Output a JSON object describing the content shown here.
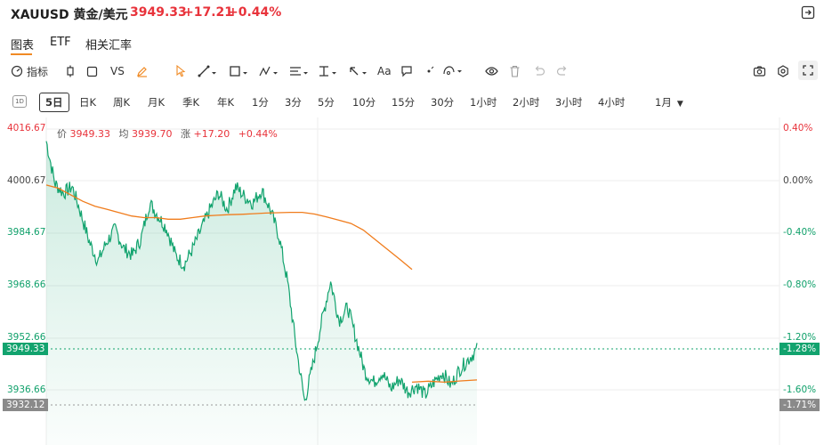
{
  "header": {
    "symbol": "XAUUSD 黄金/美元",
    "price": "3949.33",
    "change": "+17.21",
    "change_pct": "+0.44%"
  },
  "tabs": [
    {
      "label": "图表",
      "active": true
    },
    {
      "label": "ETF",
      "active": false
    },
    {
      "label": "相关汇率",
      "active": false
    }
  ],
  "toolbar": {
    "indicator_label": "指标",
    "compare_label": "VS",
    "text_tool_label": "Aa",
    "icons": [
      "gauge-icon",
      "candle-icon",
      "square-icon",
      "compare-icon",
      "pencil-icon",
      "cursor-icon",
      "line-tool-icon",
      "shape-tool-icon",
      "pattern-tool-icon",
      "fib-tool-icon",
      "measure-tool-icon",
      "arrow-tool-icon",
      "text-tool-icon",
      "comment-icon",
      "dot-icon",
      "magnet-icon",
      "eye-icon",
      "trash-icon",
      "undo-icon",
      "redo-icon",
      "camera-icon",
      "settings-icon",
      "fullscreen-icon"
    ]
  },
  "periods": {
    "box_label": "1D",
    "items": [
      "5日",
      "日K",
      "周K",
      "月K",
      "季K",
      "年K",
      "1分",
      "3分",
      "5分",
      "10分",
      "15分",
      "30分",
      "1小时",
      "2小时",
      "3小时",
      "4小时",
      "1月"
    ],
    "active": "5日"
  },
  "legend": {
    "price_label": "价",
    "price_value": "3949.33",
    "avg_label": "均",
    "avg_value": "3939.70",
    "change_label": "涨",
    "change_value": "+17.20",
    "change_pct": "+0.44%"
  },
  "axes": {
    "left_ticks": [
      "4016.67",
      "4000.67",
      "3984.67",
      "3968.66",
      "3952.66",
      "3936.66"
    ],
    "right_ticks": [
      "0.40%",
      "0.00%",
      "-0.40%",
      "-0.80%",
      "-1.20%",
      "-1.60%"
    ],
    "current_price_tag": "3949.33",
    "current_pct_tag": "-1.28%",
    "low_price_tag": "3932.12",
    "low_pct_tag": "-1.71%"
  },
  "colors": {
    "up": "#e8333b",
    "down": "#0fa06a",
    "price_line": "#12a36e",
    "avg_line": "#f07c1c",
    "accent": "#f08a24"
  },
  "chart_data": {
    "type": "area",
    "ylim": [
      3920,
      4020
    ],
    "series": [
      {
        "name": "价",
        "values": [
          4013,
          4000,
          3997,
          3999,
          3991,
          3982,
          3976,
          3982,
          3986,
          3980,
          3978,
          3983,
          3994,
          3990,
          3986,
          3978,
          3975,
          3980,
          3986,
          3992,
          3997,
          3992,
          3999,
          3996,
          3994,
          3998,
          3992,
          3984,
          3970,
          3950,
          3933,
          3945,
          3958,
          3970,
          3958,
          3962,
          3952,
          3942,
          3939,
          3942,
          3937,
          3940,
          3936,
          3938,
          3935,
          3939,
          3942,
          3938,
          3943,
          3946,
          3949
        ]
      },
      {
        "name": "均",
        "values": [
          3999.5,
          3998.5,
          3996.5,
          3994.5,
          3993,
          3992,
          3991,
          3990,
          3989.5,
          3989.5,
          3989,
          3989,
          3989.5,
          3990,
          3990.2,
          3990.4,
          3990.5,
          3990.7,
          3990.9,
          3991,
          3991.1,
          3991.1,
          3990.6,
          3989.7,
          3988.7,
          3987.7,
          3985.7,
          3982.7,
          3979.7,
          3976.7,
          3973.6
        ]
      },
      {
        "name": "均",
        "values": [
          3939,
          3939.3,
          3939,
          3939.4,
          3939.7
        ]
      }
    ]
  }
}
